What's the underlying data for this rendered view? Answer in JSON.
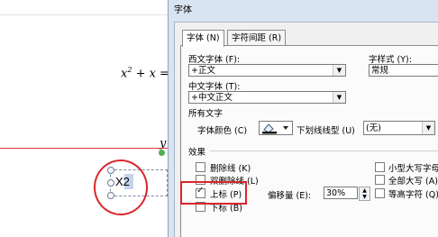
{
  "document": {
    "equation_prefix": "x",
    "equation_exponent": "2",
    "equation_suffix": " + x =",
    "equation_tail": "y",
    "selected_text_char": "X",
    "selected_text_digit": "2"
  },
  "dialog": {
    "title": "字体",
    "tabs": [
      {
        "label": "字体 (N)"
      },
      {
        "label": "字符间距 (R)"
      }
    ],
    "western_font_label": "西文字体 (F):",
    "western_font_value": "+正文",
    "font_style_label": "字样式 (Y):",
    "font_style_value": "常规",
    "chinese_font_label": "中文字体 (T):",
    "chinese_font_value": "+中文正文",
    "all_text_label": "所有文字",
    "font_color_label": "字体颜色 (C)",
    "underline_label": "下划线线型 (U)",
    "underline_value": "(无)",
    "effects_label": "效果",
    "effects": [
      {
        "label": "删除线 (K)",
        "checked": false
      },
      {
        "label": "双删除线 (L)",
        "checked": false
      },
      {
        "label": "上标 (P)",
        "checked": true
      },
      {
        "label": "下标 (B)",
        "checked": false
      }
    ],
    "offset_label": "偏移量 (E):",
    "offset_value": "30%",
    "right_effects": [
      {
        "label": "小型大写字母",
        "checked": false
      },
      {
        "label": "全部大写 (A)",
        "checked": false
      },
      {
        "label": "等高字符 (Q)",
        "checked": false
      }
    ]
  }
}
